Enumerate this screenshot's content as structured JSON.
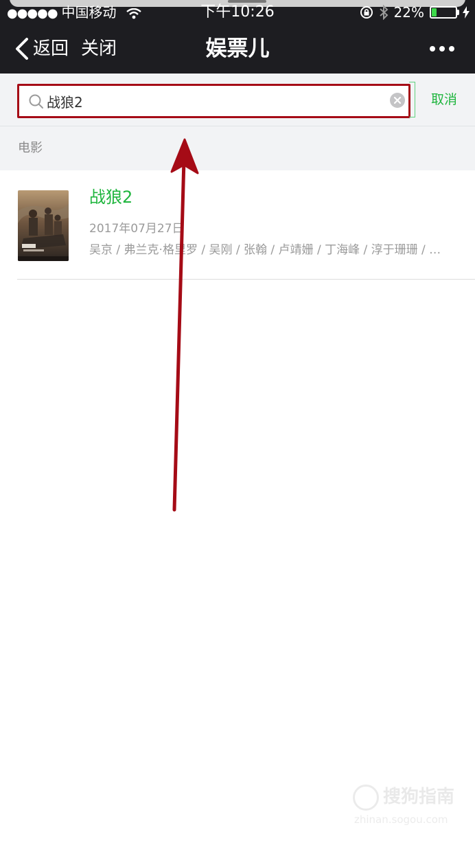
{
  "status_bar": {
    "signal_dots": "●●●●●",
    "carrier": "中国移动",
    "time": "下午10:26",
    "battery_percent": "22%",
    "battery_level": 0.22,
    "battery_color": "#3dd94a"
  },
  "nav": {
    "back_label": "返回",
    "close_label": "关闭",
    "title": "娱票儿"
  },
  "search": {
    "query": "战狼2",
    "cancel_label": "取消"
  },
  "section": {
    "label": "电影"
  },
  "results": [
    {
      "title": "战狼2",
      "release_date": "2017年07月27日",
      "cast": "吴京 / 弗兰克·格里罗 / 吴刚 / 张翰 / 卢靖姗 / 丁海峰 / 淳于珊珊 / …"
    }
  ],
  "watermark": {
    "brand": "搜狗指南",
    "url": "zhinan.sogou.com"
  },
  "colors": {
    "bar_background": "#1d1d21",
    "accent_green": "#1fb53e",
    "annotation_red": "#a50b16"
  },
  "icons": {
    "wifi": "wifi-icon",
    "orientation_lock": "orientation-lock-icon",
    "bluetooth": "bluetooth-icon",
    "charging": "charging-bolt-icon",
    "back": "chevron-left-icon",
    "more": "more-dots-icon",
    "search": "search-icon",
    "clear": "clear-icon"
  }
}
